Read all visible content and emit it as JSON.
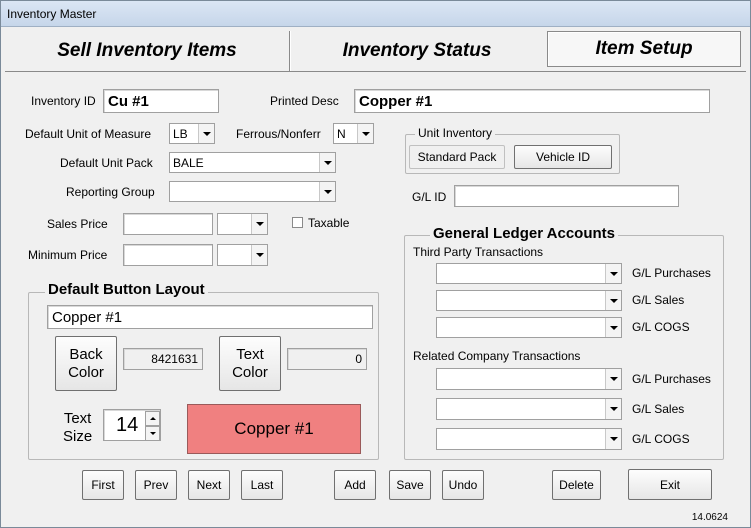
{
  "window": {
    "title": "Inventory Master",
    "version": "14.0624"
  },
  "tabs": [
    {
      "label": "Sell Inventory Items"
    },
    {
      "label": "Inventory Status"
    },
    {
      "label": "Item Setup"
    }
  ],
  "fields": {
    "inventory_id": {
      "label": "Inventory ID",
      "value": "Cu #1"
    },
    "printed_desc": {
      "label": "Printed Desc",
      "value": "Copper #1"
    },
    "default_uom": {
      "label": "Default Unit of Measure",
      "value": "LB"
    },
    "ferrous": {
      "label": "Ferrous/Nonferr",
      "value": "N"
    },
    "default_unit_pack": {
      "label": "Default Unit Pack",
      "value": "BALE"
    },
    "reporting_group": {
      "label": "Reporting Group",
      "value": ""
    },
    "sales_price": {
      "label": "Sales Price",
      "value": "",
      "unit": ""
    },
    "minimum_price": {
      "label": "Minimum Price",
      "value": "",
      "unit": ""
    },
    "taxable": {
      "label": "Taxable",
      "checked": false
    },
    "gl_id": {
      "label": "G/L ID",
      "value": ""
    }
  },
  "unit_inventory": {
    "title": "Unit Inventory",
    "standard_pack": "Standard Pack",
    "vehicle_id": "Vehicle ID"
  },
  "button_layout": {
    "title": "Default Button Layout",
    "caption": "Copper #1",
    "back_color_label": "Back\nColor",
    "back_color_value": "8421631",
    "text_color_label": "Text\nColor",
    "text_color_value": "0",
    "text_size_label": "Text\nSize",
    "text_size_value": "14",
    "preview_label": "Copper #1",
    "preview_color": "#f08080"
  },
  "gl_accounts": {
    "title": "General Ledger Accounts",
    "third_party": {
      "title": "Third Party Transactions",
      "rows": [
        {
          "label": "G/L Purchases",
          "value": ""
        },
        {
          "label": "G/L Sales",
          "value": ""
        },
        {
          "label": "G/L COGS",
          "value": ""
        }
      ]
    },
    "related": {
      "title": "Related Company Transactions",
      "rows": [
        {
          "label": "G/L Purchases",
          "value": ""
        },
        {
          "label": "G/L Sales",
          "value": ""
        },
        {
          "label": "G/L COGS",
          "value": ""
        }
      ]
    }
  },
  "nav_buttons": {
    "first": "First",
    "prev": "Prev",
    "next": "Next",
    "last": "Last",
    "add": "Add",
    "save": "Save",
    "undo": "Undo",
    "delete": "Delete",
    "exit": "Exit"
  }
}
